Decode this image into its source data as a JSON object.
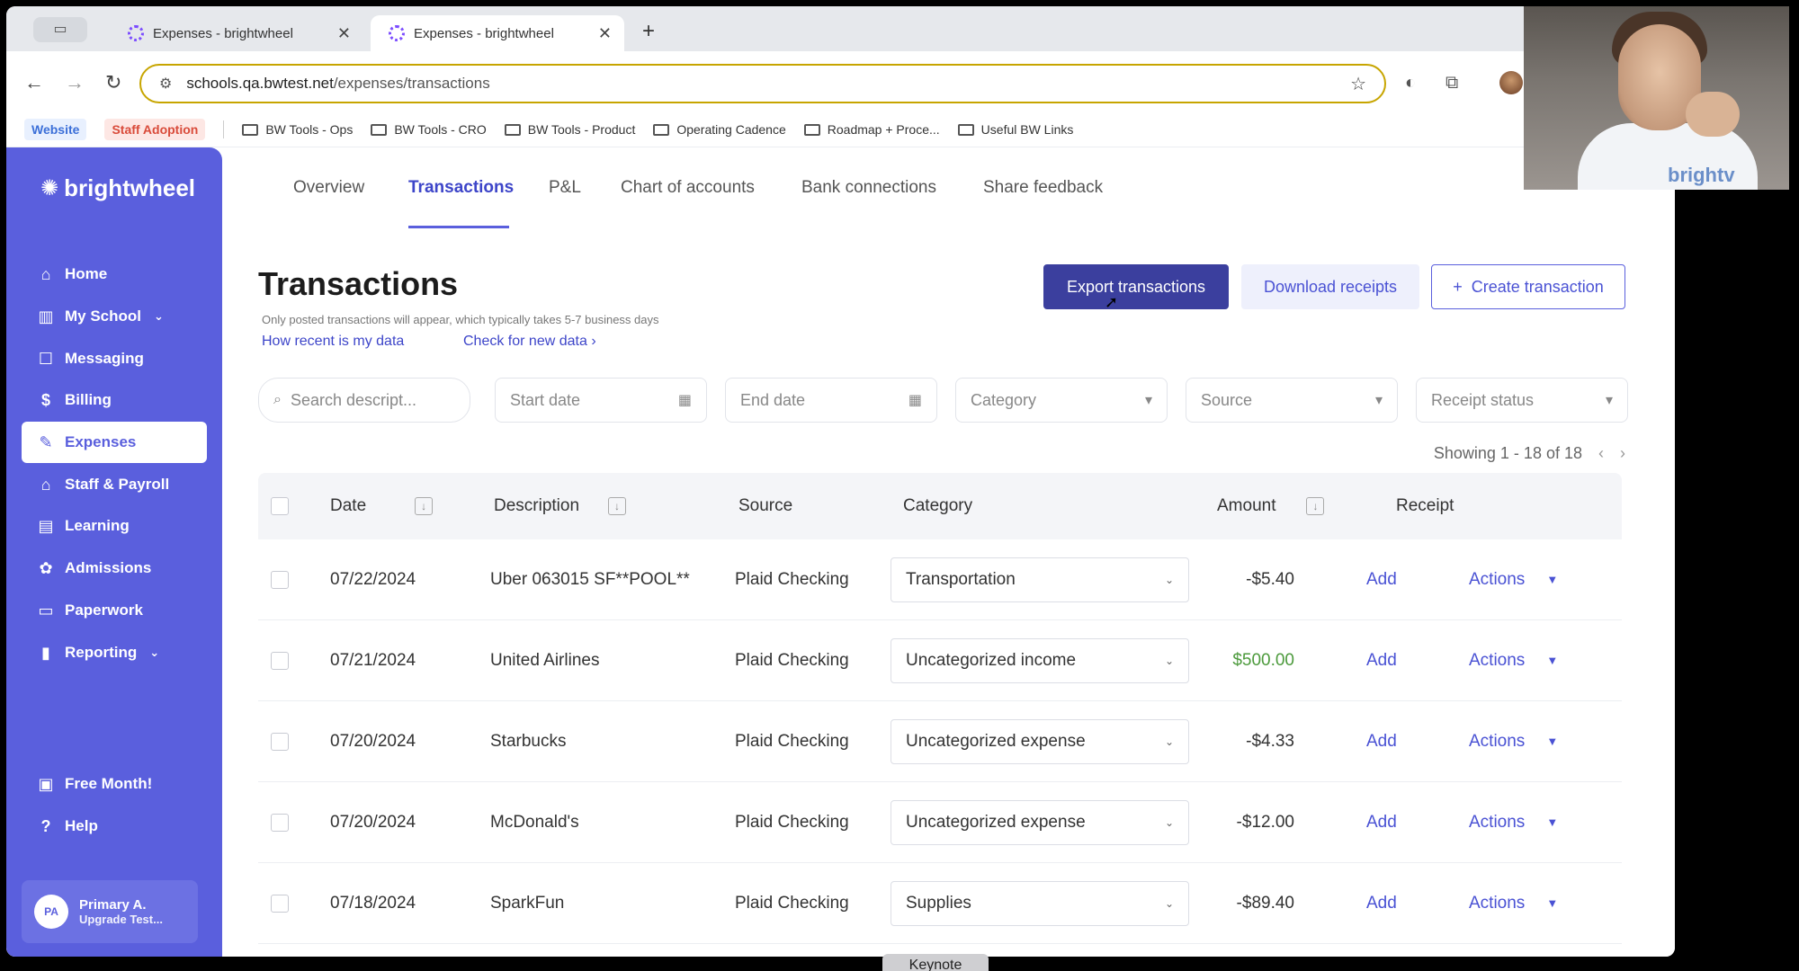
{
  "browser": {
    "tabs": [
      {
        "title": "Expenses - brightwheel"
      },
      {
        "title": "Expenses - brightwheel"
      }
    ],
    "url_host": "schools.qa.bwtest.net",
    "url_path": "/expenses/transactions",
    "bookmarks": {
      "pills": [
        "Website",
        "Staff Adoption"
      ],
      "folders": [
        "BW Tools - Ops",
        "BW Tools - CRO",
        "BW Tools - Product",
        "Operating Cadence",
        "Roadmap + Proce...",
        "Useful BW Links"
      ]
    }
  },
  "sidebar": {
    "logo": "brightwheel",
    "items": [
      {
        "label": "Home"
      },
      {
        "label": "My School"
      },
      {
        "label": "Messaging"
      },
      {
        "label": "Billing"
      },
      {
        "label": "Expenses"
      },
      {
        "label": "Staff & Payroll"
      },
      {
        "label": "Learning"
      },
      {
        "label": "Admissions"
      },
      {
        "label": "Paperwork"
      },
      {
        "label": "Reporting"
      }
    ],
    "bottom": [
      {
        "label": "Free Month!"
      },
      {
        "label": "Help"
      }
    ],
    "user": {
      "initials": "PA",
      "name": "Primary A.",
      "sub": "Upgrade Test..."
    }
  },
  "topnav": {
    "tabs": [
      "Overview",
      "Transactions",
      "P&L",
      "Chart of accounts",
      "Bank connections",
      "Share feedback"
    ]
  },
  "page": {
    "title": "Transactions",
    "note": "Only posted transactions will appear, which typically takes 5-7 business days",
    "link_recent": "How recent is my data",
    "link_check": "Check for new data",
    "btn_export": "Export transactions",
    "btn_download": "Download receipts",
    "btn_create": "Create transaction"
  },
  "filters": {
    "search_placeholder": "Search descript...",
    "start_date": "Start date",
    "end_date": "End date",
    "category": "Category",
    "source": "Source",
    "receipt_status": "Receipt status"
  },
  "pagination": {
    "showing": "Showing 1 - 18 of 18"
  },
  "table": {
    "headers": {
      "date": "Date",
      "description": "Description",
      "source": "Source",
      "category": "Category",
      "amount": "Amount",
      "receipt": "Receipt"
    },
    "rows": [
      {
        "date": "07/22/2024",
        "description": "Uber 063015 SF**POOL**",
        "source": "Plaid Checking",
        "category": "Transportation",
        "amount": "-$5.40",
        "receipt": "Add",
        "actions": "Actions"
      },
      {
        "date": "07/21/2024",
        "description": "United Airlines",
        "source": "Plaid Checking",
        "category": "Uncategorized income",
        "amount": "$500.00",
        "receipt": "Add",
        "actions": "Actions"
      },
      {
        "date": "07/20/2024",
        "description": "Starbucks",
        "source": "Plaid Checking",
        "category": "Uncategorized expense",
        "amount": "-$4.33",
        "receipt": "Add",
        "actions": "Actions"
      },
      {
        "date": "07/20/2024",
        "description": "McDonald's",
        "source": "Plaid Checking",
        "category": "Uncategorized expense",
        "amount": "-$12.00",
        "receipt": "Add",
        "actions": "Actions"
      },
      {
        "date": "07/18/2024",
        "description": "SparkFun",
        "source": "Plaid Checking",
        "category": "Supplies",
        "amount": "-$89.40",
        "receipt": "Add",
        "actions": "Actions"
      }
    ]
  },
  "webcam": {
    "shirt_text": "brightv"
  },
  "keynote": "Keynote",
  "colors": {
    "brand": "#5a5fdd",
    "primary_button": "#3b3f9e",
    "positive_amount": "#4c9a3c"
  }
}
